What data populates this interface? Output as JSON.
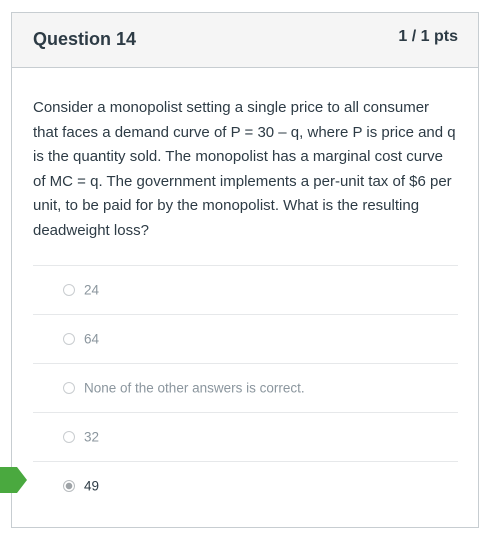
{
  "question": {
    "title": "Question 14",
    "points": "1 / 1 pts",
    "text": "Consider a monopolist setting a single price to all consumer that faces a demand curve of P = 30 – q, where P is price and q is the quantity sold. The monopolist has a marginal cost curve of MC = q. The government implements a per-unit tax of $6 per unit, to be paid for by the monopolist. What is the resulting deadweight loss?"
  },
  "answers": [
    {
      "label": "24",
      "selected": false
    },
    {
      "label": "64",
      "selected": false
    },
    {
      "label": "None of the other answers is correct.",
      "selected": false
    },
    {
      "label": "32",
      "selected": false
    },
    {
      "label": "49",
      "selected": true
    }
  ],
  "colors": {
    "correct_marker": "#4aa93f",
    "header_background": "#f5f5f5",
    "text": "#2d3b45"
  },
  "icons": {
    "correct_marker": "correct-answer-arrow-icon",
    "radio": "radio-button-icon"
  }
}
